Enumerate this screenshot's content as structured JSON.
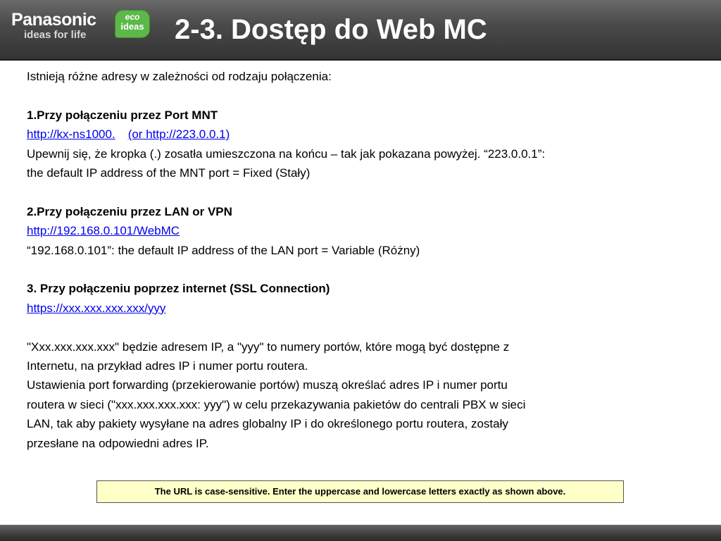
{
  "header": {
    "brand": "Panasonic",
    "tagline": "ideas for life",
    "eco_badge_line1": "eco",
    "eco_badge_line2": "ideas",
    "title": "2-3. Dostęp do Web MC",
    "colors": {
      "header_bg": "#4b4b4b",
      "eco_green": "#5db84a"
    }
  },
  "content": {
    "intro": "Istnieją różne adresy w zależności od rodzaju połączenia:",
    "section1": {
      "heading": "1.Przy połączeniu przez Port MNT",
      "link1": "http://kx-ns1000.",
      "link2": "(or http://223.0.0.1)",
      "line1": "Upewnij się, że kropka (.) zosatła umieszczona na końcu – tak jak pokazana powyżej. “223.0.0.1”:",
      "line2": "the default IP address of the MNT port = Fixed (Stały)"
    },
    "section2": {
      "heading": "2.Przy połączeniu przez LAN or VPN",
      "link": "http://192.168.0.101/WebMC",
      "line1": "“192.168.0.101”: the default IP address of the LAN port = Variable (Różny)"
    },
    "section3": {
      "heading": "3. Przy połączeniu poprzez internet (SSL Connection)",
      "link": "https://xxx.xxx.xxx.xxx/yyy"
    },
    "explanation": [
      "\"Xxx.xxx.xxx.xxx\" będzie adresem IP, a \"yyy\" to numery portów, które mogą być dostępne z",
      "Internetu, na przykład adres IP i numer portu routera.",
      "Ustawienia port forwarding (przekierowanie portów) muszą określać adres IP i numer portu",
      "routera w sieci (\"xxx.xxx.xxx.xxx: yyy\") w celu przekazywania pakietów do centrali PBX w sieci",
      "LAN, tak aby pakiety wysyłane na adres globalny IP i do określonego portu routera, zostały",
      "przesłane na odpowiedni adres IP."
    ],
    "link_color": "#0000ee"
  },
  "note": {
    "text": "The URL is case-sensitive. Enter the uppercase and lowercase letters exactly as shown above.",
    "bg_color": "#ffffc8"
  }
}
